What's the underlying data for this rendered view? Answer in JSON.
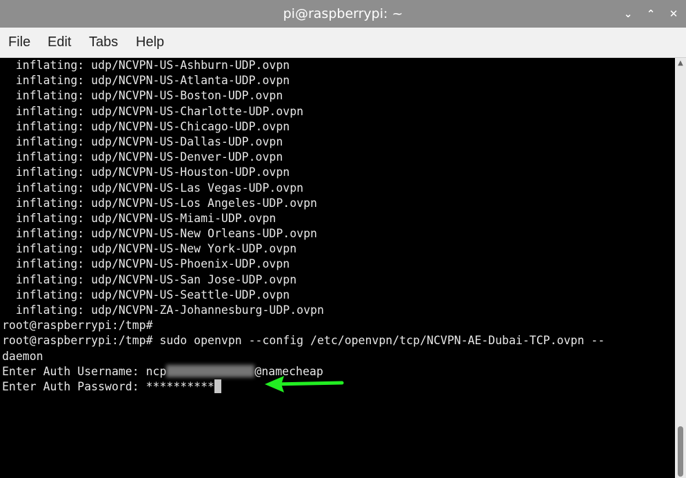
{
  "window": {
    "title": "pi@raspberrypi: ~",
    "controls": {
      "minimize": "⌄",
      "maximize": "⌃",
      "close": "✕"
    }
  },
  "menu": {
    "items": [
      "File",
      "Edit",
      "Tabs",
      "Help"
    ]
  },
  "terminal": {
    "lines": [
      "  inflating: udp/NCVPN-US-Ashburn-UDP.ovpn",
      "  inflating: udp/NCVPN-US-Atlanta-UDP.ovpn",
      "  inflating: udp/NCVPN-US-Boston-UDP.ovpn",
      "  inflating: udp/NCVPN-US-Charlotte-UDP.ovpn",
      "  inflating: udp/NCVPN-US-Chicago-UDP.ovpn",
      "  inflating: udp/NCVPN-US-Dallas-UDP.ovpn",
      "  inflating: udp/NCVPN-US-Denver-UDP.ovpn",
      "  inflating: udp/NCVPN-US-Houston-UDP.ovpn",
      "  inflating: udp/NCVPN-US-Las Vegas-UDP.ovpn",
      "  inflating: udp/NCVPN-US-Los Angeles-UDP.ovpn",
      "  inflating: udp/NCVPN-US-Miami-UDP.ovpn",
      "  inflating: udp/NCVPN-US-New Orleans-UDP.ovpn",
      "  inflating: udp/NCVPN-US-New York-UDP.ovpn",
      "  inflating: udp/NCVPN-US-Phoenix-UDP.ovpn",
      "  inflating: udp/NCVPN-US-San Jose-UDP.ovpn",
      "  inflating: udp/NCVPN-US-Seattle-UDP.ovpn",
      "  inflating: udp/NCVPN-ZA-Johannesburg-UDP.ovpn",
      "root@raspberrypi:/tmp#",
      "root@raspberrypi:/tmp# sudo openvpn --config /etc/openvpn/tcp/NCVPN-AE-Dubai-TCP.ovpn --",
      "daemon"
    ],
    "username_prefix": "Enter Auth Username: ncp",
    "username_suffix": "@namecheap",
    "password_prompt": "Enter Auth Password: ",
    "password_mask": "**********"
  },
  "annotation": {
    "arrow_color": "#22ee22"
  }
}
